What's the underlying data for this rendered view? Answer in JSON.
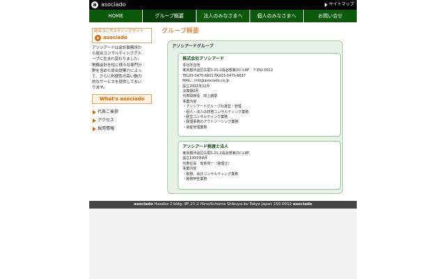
{
  "topbar": {
    "logo_letter": "a",
    "brand": "asociado",
    "sitemap": "サイトマップ"
  },
  "nav": [
    {
      "label": "HOME"
    },
    {
      "label": "グループ概要"
    },
    {
      "label": "法人のみなさまへ"
    },
    {
      "label": "個人のみなさまへ"
    },
    {
      "label": "お問い合せ"
    }
  ],
  "sidebar": {
    "box_title": "総合コンサルティングサイト",
    "box_logo_letter": "a",
    "box_logo_text": "asociado",
    "desc": [
      "アソシアードは会計事務所か",
      "ら総合コンサルティンググル",
      "ープに生まれ変わりました。",
      "税務会計を柱に様々な専門分",
      "野を含めた総合提案力によっ",
      "て、さらに利便性の高い魅力",
      "的なサービスを提供してまい",
      "ります。"
    ],
    "whats": "What's asociado",
    "links": [
      {
        "label": "代表ご挨拶"
      },
      {
        "label": "アクセス"
      },
      {
        "label": "採用情報"
      }
    ]
  },
  "main": {
    "title": "グループ概要",
    "group_title": "アソシアードグループ",
    "cards": [
      {
        "title": "株式会社アソシアード",
        "lines": [
          "本社所在地",
          "東京都渋谷区広尾5-21-2長谷部第2ビル8F　〒150-0012",
          "TEL03-5475-6821 FAX03-5475-6637",
          "MAIL：info@asociado.co.jp",
          "設立2002年12月",
          "決算期3月",
          "代表取締役　田上朗章",
          "事業内容",
          "・アソシアードグループの運営・管理",
          "・個人・法人の財務コンサルティング業務",
          "・経営コンサルティング業務",
          "・経理事務のアウトソーシング業務",
          "・資産管理業務"
        ]
      },
      {
        "title": "アソシアード税理士法人",
        "lines": [
          "東京都渋谷区広尾5-21-2長谷部第2ビル8F",
          "設立1993年8月",
          "代表社員　有賀祥一（税理士）",
          "事業内容",
          "・税務、会計コンサルティング業務",
          "・税務申告業務"
        ]
      }
    ]
  },
  "footer": {
    "brand_left": "asociado",
    "address": "Hasebe 2 bldg.-8F,21-2 Hiroo5chome Shibuya-ku Tokyo Japan 150-0012",
    "brand_right": "asociado"
  }
}
